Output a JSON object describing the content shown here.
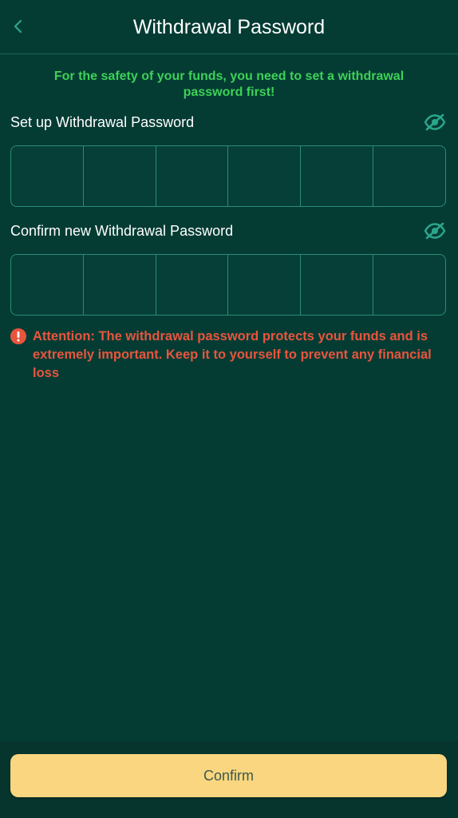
{
  "header": {
    "title": "Withdrawal Password",
    "back_icon": "chevron-left-icon"
  },
  "notice": "For the safety of your funds, you need to set a withdrawal password first!",
  "setup": {
    "label": "Set up Withdrawal Password",
    "visibility_icon": "eye-off-icon",
    "digits": [
      "",
      "",
      "",
      "",
      "",
      ""
    ]
  },
  "confirm_field": {
    "label": "Confirm new Withdrawal Password",
    "visibility_icon": "eye-off-icon",
    "digits": [
      "",
      "",
      "",
      "",
      "",
      ""
    ]
  },
  "attention": {
    "icon": "exclamation-circle-icon",
    "text": "Attention: The withdrawal password protects your funds and is extremely important. Keep it to yourself to prevent any financial loss"
  },
  "footer": {
    "confirm_label": "Confirm"
  },
  "colors": {
    "background": "#043c34",
    "accent": "#2ba68c",
    "notice_green": "#3ed158",
    "warning_red": "#e8553d",
    "button_yellow": "#f9d67f"
  }
}
